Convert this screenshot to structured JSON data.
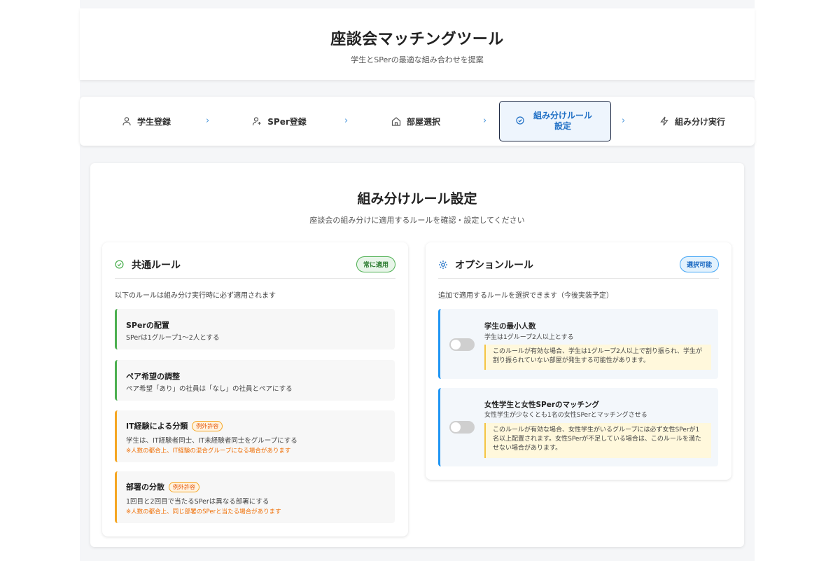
{
  "header": {
    "title": "座談会マッチングツール",
    "subtitle": "学生とSPerの最適な組み合わせを提案"
  },
  "steps": [
    {
      "label": "学生登録",
      "icon": "user-icon"
    },
    {
      "label": "SPer登録",
      "icon": "user-plus-icon"
    },
    {
      "label": "部屋選択",
      "icon": "home-icon"
    },
    {
      "label": "組み分けルール設定",
      "icon": "check-circle-icon",
      "active": true
    },
    {
      "label": "組み分け実行",
      "icon": "lightning-icon"
    }
  ],
  "main": {
    "title": "組み分けルール設定",
    "subtitle": "座談会の組み分けに適用するルールを確認・設定してください"
  },
  "common": {
    "title": "共通ルール",
    "badge": "常に適用",
    "desc": "以下のルールは組み分け実行時に必ず適用されます",
    "rules": [
      {
        "title": "SPerの配置",
        "desc": "SPerは1グループ1〜2人とする",
        "note": "",
        "exception": ""
      },
      {
        "title": "ペア希望の調整",
        "desc": "ペア希望「あり」の社員は「なし」の社員とペアにする",
        "note": "",
        "exception": ""
      },
      {
        "title": "IT経験による分類",
        "desc": "学生は、IT経験者同士、IT未経験者同士をグループにする",
        "note": "※人数の都合上、IT経験の混合グループになる場合があります",
        "exception": "例外許容"
      },
      {
        "title": "部署の分散",
        "desc": "1回目と2回目で当たるSPerは異なる部署にする",
        "note": "※人数の都合上、同じ部署のSPerと当たる場合があります",
        "exception": "例外許容"
      }
    ]
  },
  "optional": {
    "title": "オプションルール",
    "badge": "選択可能",
    "desc": "追加で適用するルールを選択できます（今後実装予定）",
    "rules": [
      {
        "title": "学生の最小人数",
        "desc": "学生は1グループ2人以上とする",
        "warning": "このルールが有効な場合、学生は1グループ2人以上で割り振られ、学生が割り振られていない部屋が発生する可能性があります。",
        "enabled": false
      },
      {
        "title": "女性学生と女性SPerのマッチング",
        "desc": "女性学生が少なくとも1名の女性SPerとマッチングさせる",
        "warning": "このルールが有効な場合、女性学生がいるグループには必ず女性SPerが1名以上配置されます。女性SPerが不足している場合は、このルールを満たせない場合があります。",
        "enabled": false
      }
    ]
  },
  "colors": {
    "accent": "#1f6fc5",
    "green": "#4caf50",
    "orange": "#f5a623",
    "blue": "#2196f3"
  }
}
